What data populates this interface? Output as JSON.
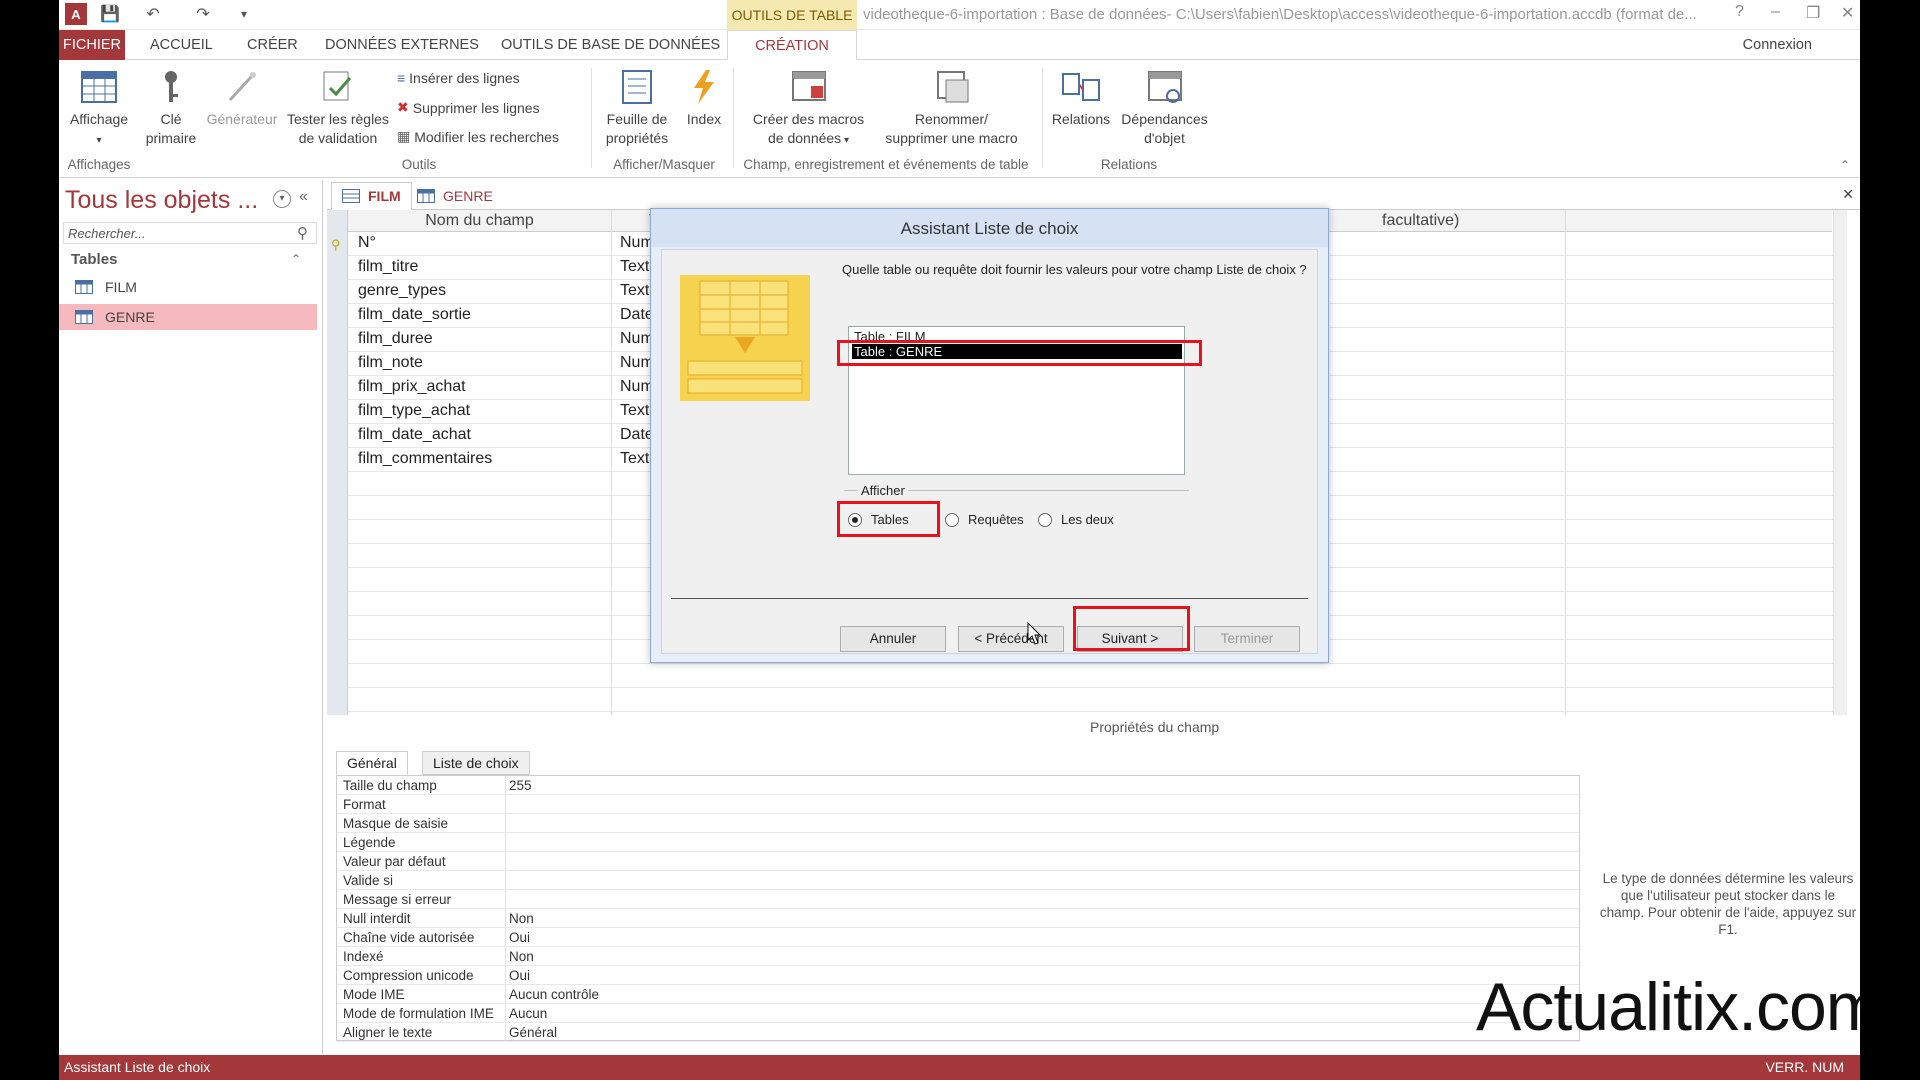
{
  "titlebar": {
    "context_group": "OUTILS DE TABLE",
    "window_title": "videotheque-6-importation : Base de données- C:\\Users\\fabien\\Desktop\\access\\videotheque-6-importation.accdb (format de...",
    "help": "?"
  },
  "tabs": {
    "fichier": "FICHIER",
    "accueil": "ACCUEIL",
    "creer": "CRÉER",
    "donnees_externes": "DONNÉES EXTERNES",
    "outils_bd": "OUTILS DE BASE DE DONNÉES",
    "creation": "CRÉATION",
    "connexion": "Connexion"
  },
  "ribbon": {
    "affichage": "Affichage",
    "cle_1": "Clé",
    "cle_2": "primaire",
    "generateur": "Générateur",
    "tester_1": "Tester les règles",
    "tester_2": "de validation",
    "inserer": "Insérer des lignes",
    "supprimer": "Supprimer les lignes",
    "modifier": "Modifier les recherches",
    "feuille_1": "Feuille de",
    "feuille_2": "propriétés",
    "index": "Index",
    "macros_1": "Créer des macros",
    "macros_2": "de données",
    "renommer_1": "Renommer/",
    "renommer_2": "supprimer une macro",
    "relations": "Relations",
    "dependances_1": "Dépendances",
    "dependances_2": "d'objet",
    "group_affichages": "Affichages",
    "group_outils": "Outils",
    "group_afficher": "Afficher/Masquer",
    "group_champ": "Champ, enregistrement et événements de table",
    "group_relations": "Relations"
  },
  "nav": {
    "title": "Tous les objets ...",
    "search_placeholder": "Rechercher...",
    "section": "Tables",
    "items": [
      "FILM",
      "GENRE"
    ]
  },
  "doc_tabs": [
    "FILM",
    "GENRE"
  ],
  "grid": {
    "col_name": "Nom du champ",
    "col_type": "Typ",
    "col_desc": "facultative)",
    "rows": [
      {
        "name": "N°",
        "type": "Numér"
      },
      {
        "name": "film_titre",
        "type": "Texte c"
      },
      {
        "name": "genre_types",
        "type": "Texte c"
      },
      {
        "name": "film_date_sortie",
        "type": "Date/H"
      },
      {
        "name": "film_duree",
        "type": "Numér"
      },
      {
        "name": "film_note",
        "type": "Numér"
      },
      {
        "name": "film_prix_achat",
        "type": "Numér"
      },
      {
        "name": "film_type_achat",
        "type": "Texte c"
      },
      {
        "name": "film_date_achat",
        "type": "Date/H"
      },
      {
        "name": "film_commentaires",
        "type": "Texte l"
      }
    ]
  },
  "props": {
    "title": "Propriétés du champ",
    "tab_general": "Général",
    "tab_liste": "Liste de choix",
    "rows": [
      {
        "label": "Taille du champ",
        "value": "255"
      },
      {
        "label": "Format",
        "value": ""
      },
      {
        "label": "Masque de saisie",
        "value": ""
      },
      {
        "label": "Légende",
        "value": ""
      },
      {
        "label": "Valeur par défaut",
        "value": ""
      },
      {
        "label": "Valide si",
        "value": ""
      },
      {
        "label": "Message si erreur",
        "value": ""
      },
      {
        "label": "Null interdit",
        "value": "Non"
      },
      {
        "label": "Chaîne vide autorisée",
        "value": "Oui"
      },
      {
        "label": "Indexé",
        "value": "Non"
      },
      {
        "label": "Compression unicode",
        "value": "Oui"
      },
      {
        "label": "Mode IME",
        "value": "Aucun contrôle"
      },
      {
        "label": "Mode de formulation IME",
        "value": "Aucun"
      },
      {
        "label": "Aligner le texte",
        "value": "Général"
      }
    ],
    "help": "Le type de données détermine les valeurs que l'utilisateur peut stocker dans le champ. Pour obtenir de l'aide, appuyez sur F1."
  },
  "dialog": {
    "title": "Assistant Liste de choix",
    "question": "Quelle table ou requête doit fournir les valeurs pour votre champ Liste de choix ?",
    "list": [
      "Table : FILM",
      "Table : GENRE"
    ],
    "selected_index": 1,
    "group_label": "Afficher",
    "radios": [
      "Tables",
      "Requêtes",
      "Les deux"
    ],
    "radio_selected": 0,
    "btn_annuler": "Annuler",
    "btn_precedent": "< Précédent",
    "btn_suivant": "Suivant >",
    "btn_terminer": "Terminer"
  },
  "status": {
    "left": "Assistant Liste de choix",
    "right": "VERR. NUM"
  },
  "watermark": "Actualitix.com",
  "colors": {
    "accent": "#a4373a",
    "highlight": "#e8121c",
    "context_tab": "#f6e8b1"
  }
}
